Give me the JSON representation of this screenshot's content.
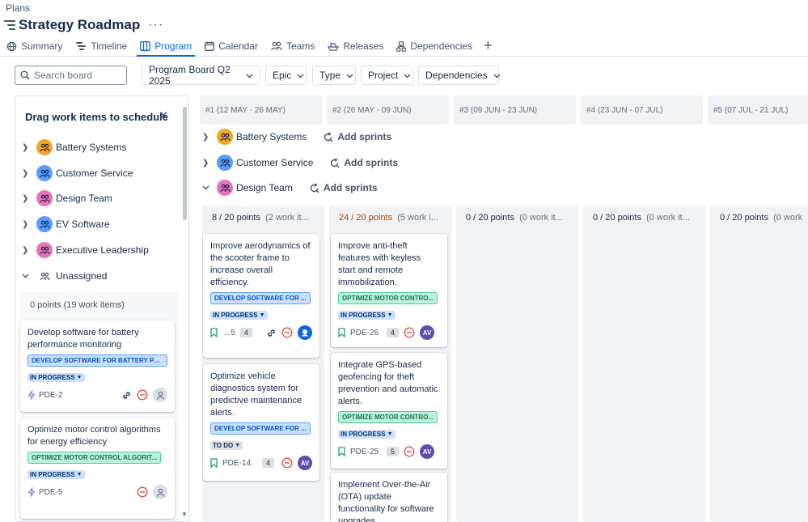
{
  "breadcrumb": "Plans",
  "title": "Strategy Roadmap",
  "more_label": "···",
  "tabs": [
    {
      "label": "Summary",
      "icon": "globe-icon",
      "active": false
    },
    {
      "label": "Timeline",
      "icon": "timeline-icon",
      "active": false
    },
    {
      "label": "Program",
      "icon": "board-icon",
      "active": true
    },
    {
      "label": "Calendar",
      "icon": "calendar-icon",
      "active": false
    },
    {
      "label": "Teams",
      "icon": "teams-icon",
      "active": false
    },
    {
      "label": "Releases",
      "icon": "ship-icon",
      "active": false
    },
    {
      "label": "Dependencies",
      "icon": "dependencies-icon",
      "active": false
    }
  ],
  "add_tab": "+",
  "search": {
    "placeholder": "Search board"
  },
  "filters": [
    "Program Board Q2 2025",
    "Epic",
    "Type",
    "Project",
    "Dependencies"
  ],
  "panel": {
    "title": "Drag work items to schedule",
    "teams": [
      {
        "name": "Battery Systems",
        "color": "#f5a623"
      },
      {
        "name": "Customer Service",
        "color": "#579dff"
      },
      {
        "name": "Design Team",
        "color": "#e774bb"
      },
      {
        "name": "EV Software",
        "color": "#579dff"
      },
      {
        "name": "Executive Leadership",
        "color": "#e774bb"
      },
      {
        "name": "Unassigned",
        "color": ""
      }
    ],
    "unassigned_summary": "0 points",
    "unassigned_count": "(19 work items)",
    "cards": [
      {
        "summary": "Develop software for battery performance monitoring",
        "epic": "DEVELOP SOFTWARE FOR BATTERY PE...",
        "status": "IN PROGRESS",
        "key": "PDE-2"
      },
      {
        "summary": "Optimize motor control algorithms for energy efficiency",
        "epic": "OPTIMIZE MOTOR CONTROL ALGORIT...",
        "status": "IN PROGRESS",
        "key": "PDE-5"
      }
    ]
  },
  "sprints": [
    "#1 (12 MAY - 26 MAY)",
    "#2 (26 MAY - 09 JUN)",
    "#3 (09 JUN - 23 JUN)",
    "#4 (23 JUN - 07 JUL)",
    "#5 (07 JUL - 21 JUL)"
  ],
  "groups": [
    {
      "name": "Battery Systems",
      "color": "#f5a623",
      "expanded": false
    },
    {
      "name": "Customer Service",
      "color": "#579dff",
      "expanded": false
    },
    {
      "name": "Design Team",
      "color": "#e774bb",
      "expanded": true
    }
  ],
  "add_sprints_label": "Add sprints",
  "columns": [
    {
      "points": "8",
      "capacity": "20",
      "unit": "points",
      "count": "(2 work it...",
      "over": false
    },
    {
      "points": "24",
      "capacity": "20",
      "unit": "points",
      "count": "(5 work i...",
      "over": true
    },
    {
      "points": "0",
      "capacity": "20",
      "unit": "points",
      "count": "(0 work it...",
      "over": false
    },
    {
      "points": "0",
      "capacity": "20",
      "unit": "points",
      "count": "(0 work it...",
      "over": false
    },
    {
      "points": "0",
      "capacity": "20",
      "unit": "points",
      "count": "(0 work",
      "over": false
    }
  ],
  "col1_cards": [
    {
      "summary": "Improve aerodynamics of the scooter frame to increase overall efficiency.",
      "epic": "DEVELOP SOFTWARE FOR ...",
      "status": "IN PROGRESS",
      "key": "...5",
      "estimate": "4"
    },
    {
      "summary": "Optimize vehicle diagnostics system for predictive maintenance alerts.",
      "epic": "DEVELOP SOFTWARE FOR ...",
      "status": "TO DO",
      "key": "PDE-14",
      "estimate": "4",
      "assignee": "AV"
    }
  ],
  "col2_cards": [
    {
      "summary": "Improve anti-theft features with keyless start and remote immobilization.",
      "epic": "OPTIMIZE MOTOR CONTRO...",
      "status": "IN PROGRESS",
      "key": "PDE-26",
      "estimate": "4",
      "assignee": "AV"
    },
    {
      "summary": "Integrate GPS-based geofencing for theft prevention and automatic alerts.",
      "epic": "OPTIMIZE MOTOR CONTRO...",
      "status": "IN PROGRESS",
      "key": "PDE-25",
      "estimate": "5",
      "assignee": "AV"
    },
    {
      "summary": "Implement Over-the-Air (OTA) update functionality for software upgrades."
    }
  ]
}
